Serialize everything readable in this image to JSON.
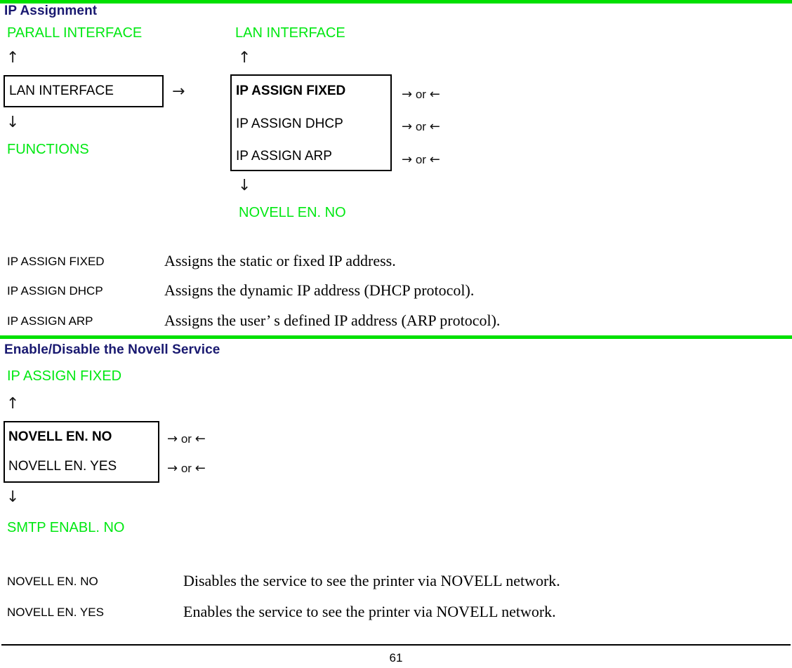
{
  "colors": {
    "heading": "#191970",
    "menu_green": "#00e812",
    "rule_green": "#00e000",
    "box_border": "#000000"
  },
  "page": {
    "number": "61"
  },
  "sections": [
    {
      "heading": "IP Assignment",
      "parent_left": "PARALL INTERFACE",
      "parent_right": "LAN INTERFACE",
      "left_box": {
        "rows": [
          {
            "label": "LAN INTERFACE",
            "selected": false
          }
        ],
        "transition": "→"
      },
      "left_next": "FUNCTIONS",
      "right_box": {
        "rows": [
          {
            "label": "IP ASSIGN  FIXED",
            "selected": true,
            "keys": "or"
          },
          {
            "label": "IP ASSIGN  DHCP",
            "selected": false,
            "keys": "or"
          },
          {
            "label": "IP ASSIGN  ARP",
            "selected": false,
            "keys": "or"
          }
        ]
      },
      "right_next": "NOVELL EN. NO",
      "up_arrow": "↑",
      "down_arrow": "↓",
      "right_arrow": "→",
      "left_arrow": "←",
      "or_word": "or",
      "descriptions": [
        {
          "term": "IP ASSIGN   FIXED",
          "text": "Assigns the static or fixed IP address."
        },
        {
          "term": "IP ASSIGN   DHCP",
          "text": "Assigns the dynamic IP address (DHCP protocol)."
        },
        {
          "term": "IP ASSIGN   ARP",
          "text": "Assigns the user’ s defined IP address (ARP protocol)."
        }
      ]
    },
    {
      "heading": "Enable/Disable the Novell Service",
      "parent": "IP ASSIGN  FIXED",
      "box": {
        "rows": [
          {
            "label": "NOVELL EN. NO",
            "selected": true,
            "keys": "or"
          },
          {
            "label": "NOVELL EN. YES",
            "selected": false,
            "keys": "or"
          }
        ]
      },
      "next": "SMTP ENABL. NO",
      "descriptions": [
        {
          "term": "NOVELL EN. NO",
          "text": "Disables the service to see the printer via NOVELL network."
        },
        {
          "term": "NOVELL EN. YES",
          "text": "Enables the service to see the printer via NOVELL network."
        }
      ]
    }
  ]
}
